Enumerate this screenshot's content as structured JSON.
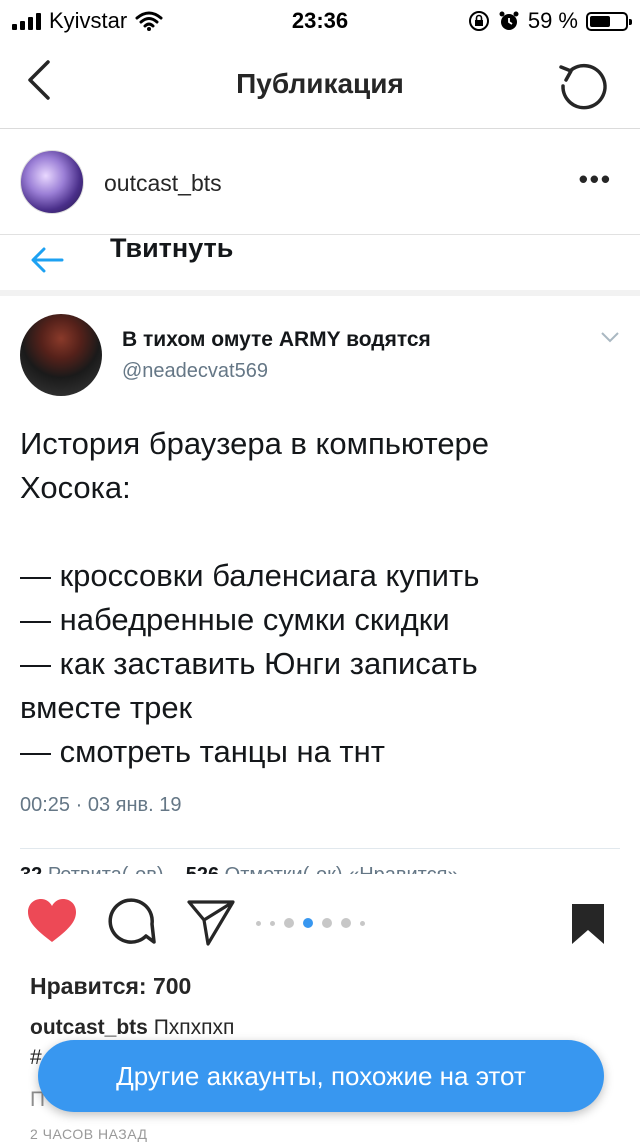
{
  "status_bar": {
    "carrier": "Kyivstar",
    "time": "23:36",
    "battery_percent": "59 %",
    "battery_level": 0.59
  },
  "nav": {
    "title": "Публикация",
    "back_icon": "chevron-left-icon",
    "right_icon": "refresh-icon"
  },
  "post": {
    "username": "outcast_bts",
    "more_icon": "more-horizontal-icon"
  },
  "tweet": {
    "header_title": "Твитнуть",
    "author_name": "В тихом омуте ARMY водятся",
    "author_handle": "@neadecvat569",
    "lines": [
      "История браузера в компьютере",
      "Хосока:",
      "",
      "— кроссовки баленсиага купить",
      "— набедренные сумки скидки",
      "— как заставить Юнги записать",
      "вместе трек",
      "— смотреть танцы на тнт"
    ],
    "timestamp": "00:25 · 03 янв. 19",
    "retweets_count": "32",
    "retweets_label": "Ретвита(-ов)",
    "likes_count": "526",
    "likes_label": "Отметки(-ок) «Нравится»"
  },
  "actions": {
    "like_icon": "heart-filled-icon",
    "comment_icon": "comment-icon",
    "share_icon": "send-icon",
    "save_icon": "bookmark-filled-icon",
    "carousel_total": 7,
    "carousel_active": 3
  },
  "likes_text": "Нравится: 700",
  "caption": {
    "username": "outcast_bts",
    "text": "Пхпхпхп",
    "hashtag_peek": "#",
    "comments_peek": "П"
  },
  "time_ago": "2 ЧАСОВ НАЗАД",
  "toast": {
    "label": "Другие аккаунты, похожие на этот"
  },
  "colors": {
    "accent_blue": "#3897f0",
    "like_red": "#ed4956",
    "twitter_blue": "#1da1f2"
  }
}
